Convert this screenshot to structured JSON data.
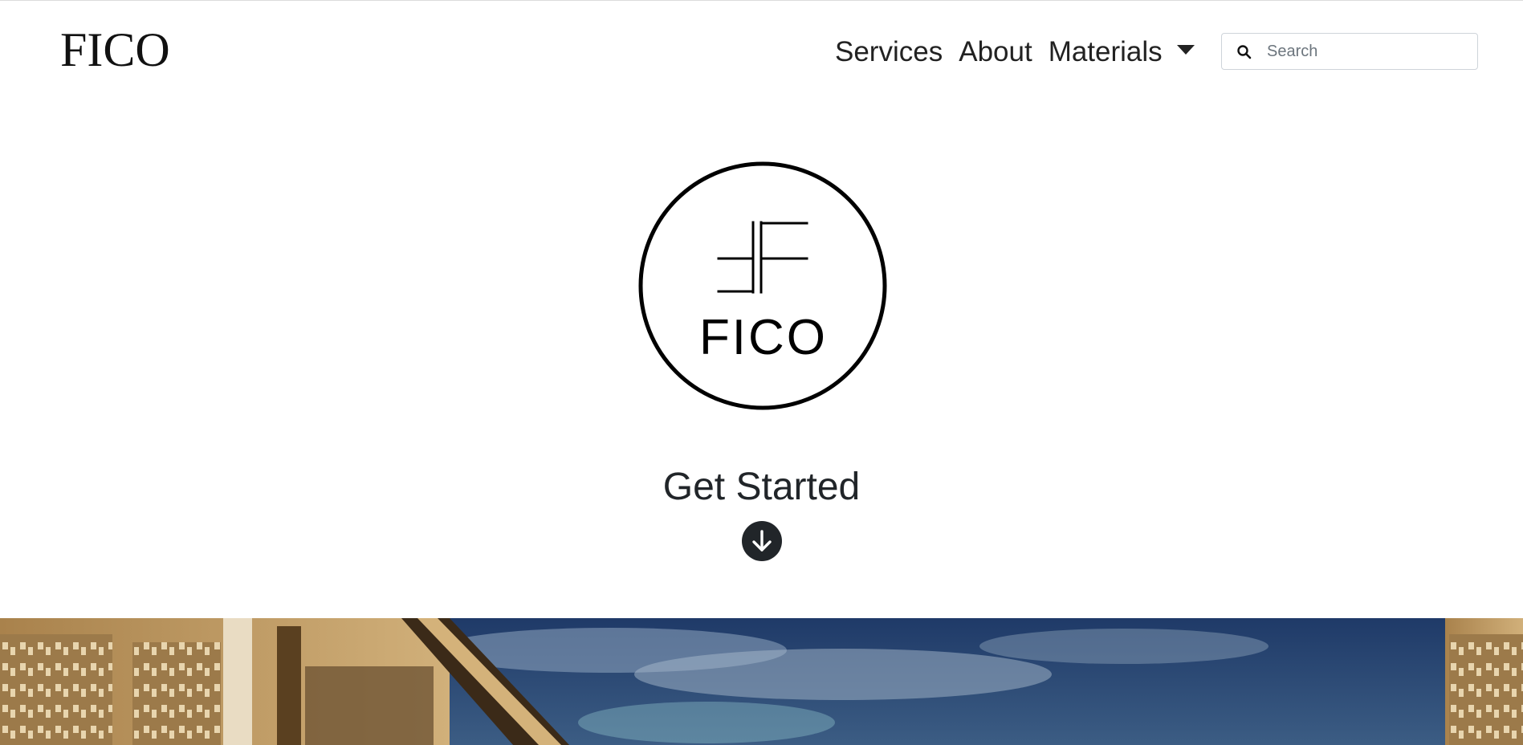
{
  "navbar": {
    "brand": "FICO",
    "links": [
      {
        "label": "Services"
      },
      {
        "label": "About"
      },
      {
        "label": "Materials"
      }
    ],
    "search": {
      "placeholder": "Search",
      "value": "",
      "icon": "search-icon"
    }
  },
  "hero": {
    "logo_text": "FICO",
    "title": "Get Started",
    "down_icon": "arrow-down-circle-icon"
  },
  "colors": {
    "text": "#212529",
    "button_bg": "#212529",
    "sky": "#2c4a78",
    "wood": "#b8925a"
  }
}
